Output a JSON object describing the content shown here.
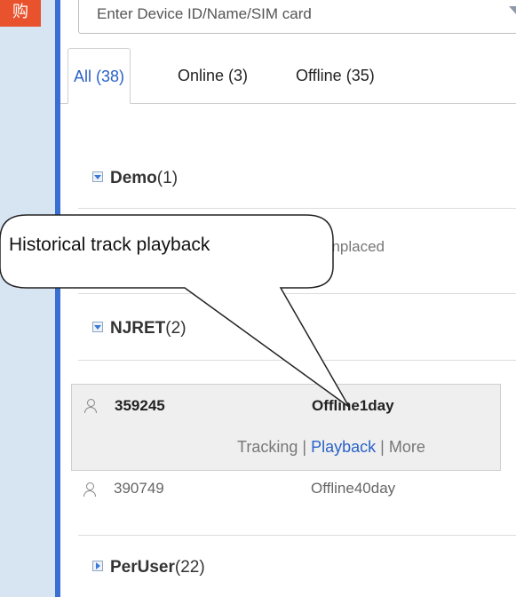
{
  "sidebar": {
    "badge_text": "购"
  },
  "search": {
    "placeholder": "Enter Device ID/Name/SIM card"
  },
  "tabs": [
    {
      "label": "All (38)"
    },
    {
      "label": "Online (3)"
    },
    {
      "label": "Offline (35)"
    }
  ],
  "groups": [
    {
      "name": "Demo",
      "count": "(1)",
      "expanded": true
    },
    {
      "name": "NJRET",
      "count": "(2)",
      "expanded": true
    },
    {
      "name": "PerUser",
      "count": "(22)",
      "expanded": false
    }
  ],
  "demo_device": {
    "status": "unplaced"
  },
  "devices": [
    {
      "id": "359245",
      "status": "Offline1day"
    },
    {
      "id": "390749",
      "status": "Offline40day"
    }
  ],
  "actions": {
    "tracking": "Tracking",
    "sep": "|",
    "playback": "Playback",
    "more": "More"
  },
  "callout": {
    "text": "Historical track playback"
  },
  "colors": {
    "accent_blue": "#3a6fd2",
    "link_blue": "#2b62c8",
    "badge_red": "#e8532d"
  }
}
